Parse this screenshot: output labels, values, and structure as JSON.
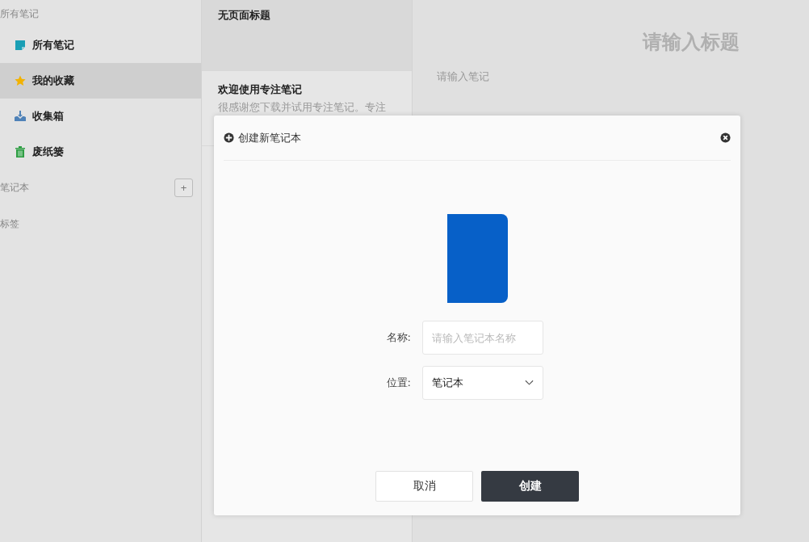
{
  "sidebar": {
    "heading": "所有笔记",
    "items": [
      {
        "label": "所有笔记",
        "kind": "note",
        "selected": false
      },
      {
        "label": "我的收藏",
        "kind": "star",
        "selected": true
      },
      {
        "label": "收集箱",
        "kind": "inbox",
        "selected": false
      },
      {
        "label": "废纸篓",
        "kind": "trash",
        "selected": false
      }
    ],
    "sections": [
      {
        "label": "笔记本",
        "add_button": "+"
      },
      {
        "label": "标签"
      }
    ]
  },
  "notes": [
    {
      "title": "无页面标题",
      "selected": true
    },
    {
      "title": "欢迎使用专注笔记",
      "snippet": "很感谢您下载并试用专注笔记。专注",
      "selected": false
    }
  ],
  "editor": {
    "title_placeholder": "请输入标题",
    "body_placeholder": "请输入笔记"
  },
  "dialog": {
    "title": "创建新笔记本",
    "fields": [
      {
        "label": "名称:",
        "kind": "input",
        "placeholder": "请输入笔记本名称"
      },
      {
        "label": "位置:",
        "kind": "select",
        "value": "笔记本"
      }
    ],
    "buttons": [
      {
        "label": "取消",
        "kind": "secondary"
      },
      {
        "label": "创建",
        "kind": "primary"
      }
    ]
  }
}
